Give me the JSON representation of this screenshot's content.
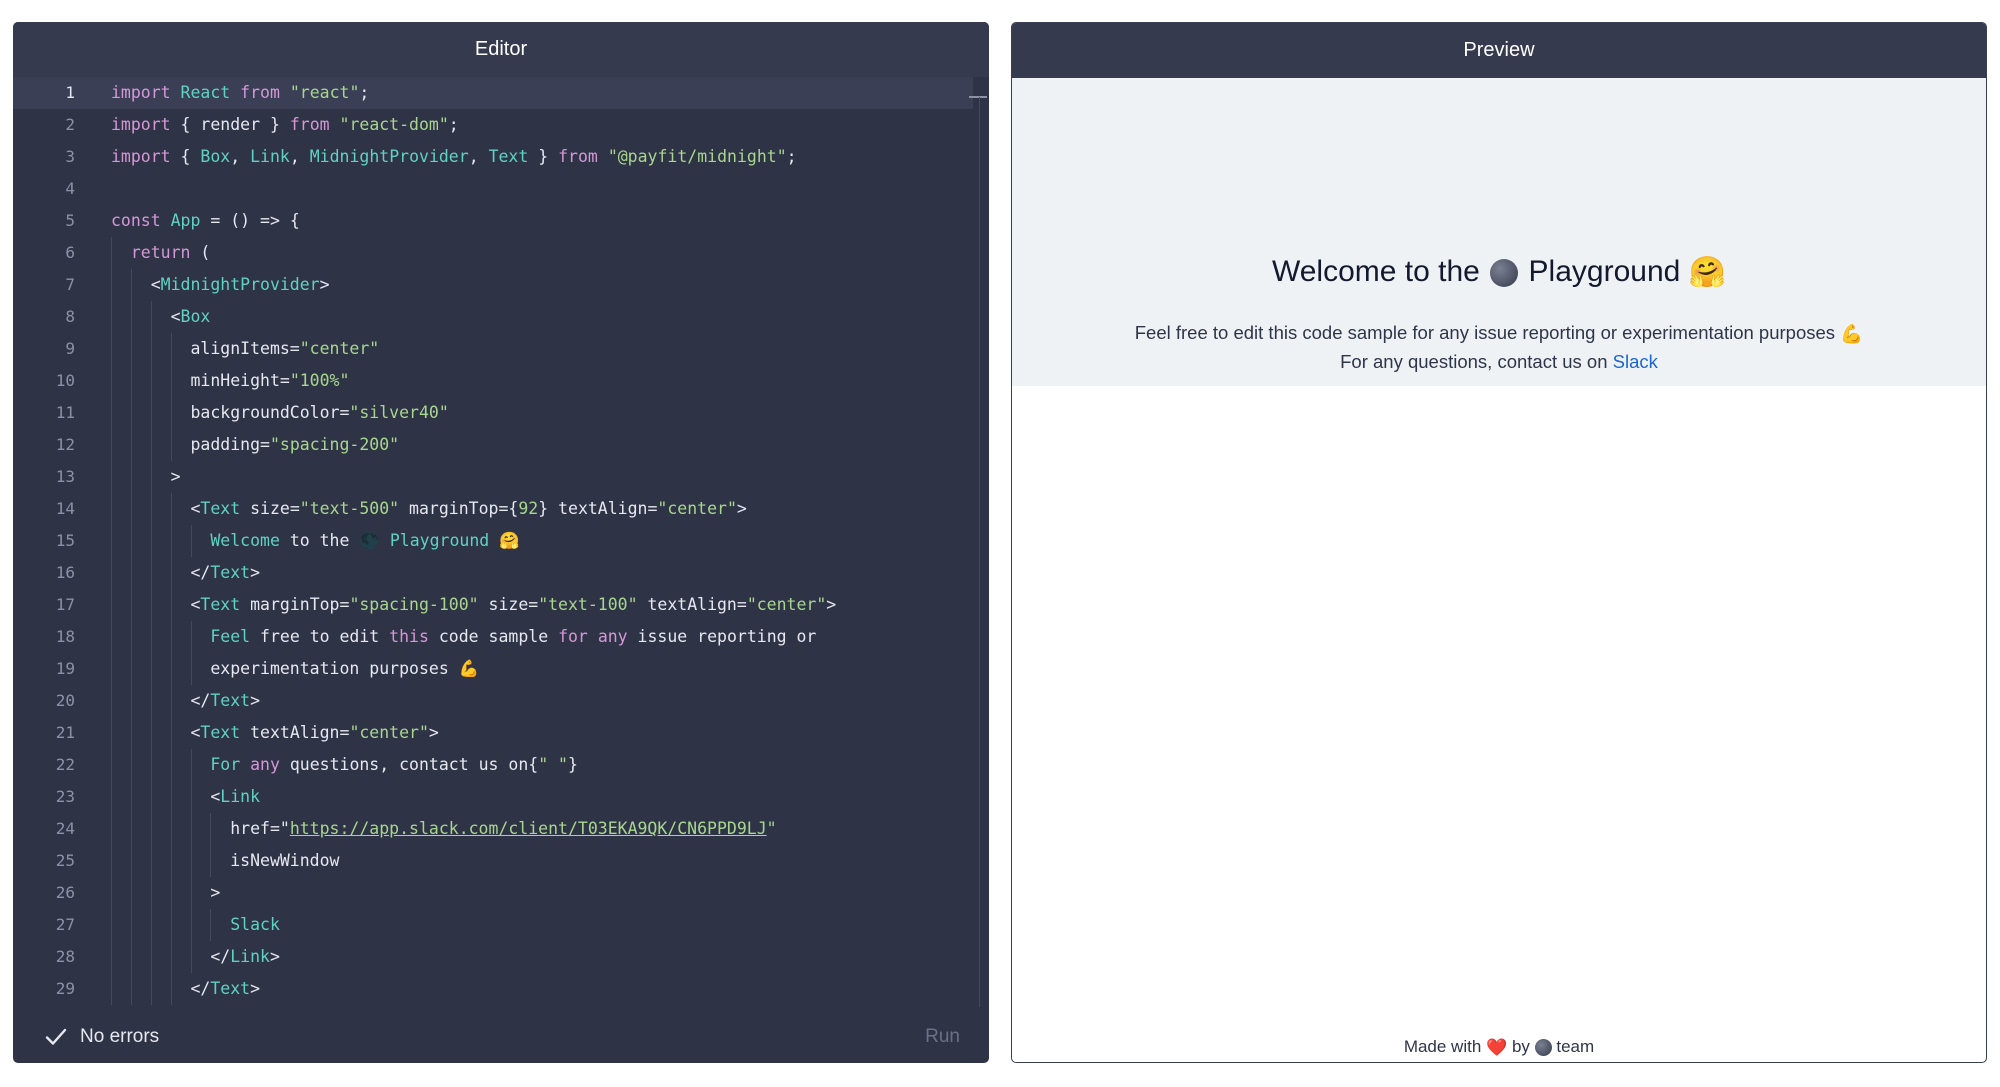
{
  "editor": {
    "title": "Editor",
    "lines": [
      [
        {
          "t": "import",
          "c": "kw"
        },
        {
          "t": " "
        },
        {
          "t": "React",
          "c": "ty"
        },
        {
          "t": " "
        },
        {
          "t": "from",
          "c": "kw"
        },
        {
          "t": " "
        },
        {
          "t": "\"react\"",
          "c": "st"
        },
        {
          "t": ";"
        }
      ],
      [
        {
          "t": "import",
          "c": "kw"
        },
        {
          "t": " { render } "
        },
        {
          "t": "from",
          "c": "kw"
        },
        {
          "t": " "
        },
        {
          "t": "\"react-dom\"",
          "c": "st"
        },
        {
          "t": ";"
        }
      ],
      [
        {
          "t": "import",
          "c": "kw"
        },
        {
          "t": " { "
        },
        {
          "t": "Box",
          "c": "ty"
        },
        {
          "t": ", "
        },
        {
          "t": "Link",
          "c": "ty"
        },
        {
          "t": ", "
        },
        {
          "t": "MidnightProvider",
          "c": "ty"
        },
        {
          "t": ", "
        },
        {
          "t": "Text",
          "c": "ty"
        },
        {
          "t": " } "
        },
        {
          "t": "from",
          "c": "kw"
        },
        {
          "t": " "
        },
        {
          "t": "\"@payfit/midnight\"",
          "c": "st"
        },
        {
          "t": ";"
        }
      ],
      [],
      [
        {
          "t": "const",
          "c": "kw"
        },
        {
          "t": " "
        },
        {
          "t": "App",
          "c": "ty"
        },
        {
          "t": " = () => {"
        }
      ],
      [
        {
          "t": "  "
        },
        {
          "t": "return",
          "c": "kw"
        },
        {
          "t": " ("
        }
      ],
      [
        {
          "t": "    <"
        },
        {
          "t": "MidnightProvider",
          "c": "ty"
        },
        {
          "t": ">"
        }
      ],
      [
        {
          "t": "      <"
        },
        {
          "t": "Box",
          "c": "ty"
        }
      ],
      [
        {
          "t": "        alignItems="
        },
        {
          "t": "\"center\"",
          "c": "st"
        }
      ],
      [
        {
          "t": "        minHeight="
        },
        {
          "t": "\"100%\"",
          "c": "st"
        }
      ],
      [
        {
          "t": "        backgroundColor="
        },
        {
          "t": "\"silver40\"",
          "c": "st"
        }
      ],
      [
        {
          "t": "        padding="
        },
        {
          "t": "\"spacing-200\"",
          "c": "st"
        }
      ],
      [
        {
          "t": "      >"
        }
      ],
      [
        {
          "t": "        <"
        },
        {
          "t": "Text",
          "c": "ty"
        },
        {
          "t": " size="
        },
        {
          "t": "\"text-500\"",
          "c": "st"
        },
        {
          "t": " marginTop={"
        },
        {
          "t": "92",
          "c": "st"
        },
        {
          "t": "} textAlign="
        },
        {
          "t": "\"center\"",
          "c": "st"
        },
        {
          "t": ">"
        }
      ],
      [
        {
          "t": "          "
        },
        {
          "t": "Welcome",
          "c": "ty"
        },
        {
          "t": " to the "
        },
        {
          "t": "🌑"
        },
        {
          "t": " "
        },
        {
          "t": "Playground",
          "c": "ty"
        },
        {
          "t": " "
        },
        {
          "t": "🤗"
        }
      ],
      [
        {
          "t": "        </"
        },
        {
          "t": "Text",
          "c": "ty"
        },
        {
          "t": ">"
        }
      ],
      [
        {
          "t": "        <"
        },
        {
          "t": "Text",
          "c": "ty"
        },
        {
          "t": " marginTop="
        },
        {
          "t": "\"spacing-100\"",
          "c": "st"
        },
        {
          "t": " size="
        },
        {
          "t": "\"text-100\"",
          "c": "st"
        },
        {
          "t": " textAlign="
        },
        {
          "t": "\"center\"",
          "c": "st"
        },
        {
          "t": ">"
        }
      ],
      [
        {
          "t": "          "
        },
        {
          "t": "Feel",
          "c": "ty"
        },
        {
          "t": " free to edit "
        },
        {
          "t": "this",
          "c": "kw"
        },
        {
          "t": " code sample "
        },
        {
          "t": "for",
          "c": "kw"
        },
        {
          "t": " "
        },
        {
          "t": "any",
          "c": "kw"
        },
        {
          "t": " issue reporting or"
        }
      ],
      [
        {
          "t": "          experimentation purposes "
        },
        {
          "t": "💪"
        }
      ],
      [
        {
          "t": "        </"
        },
        {
          "t": "Text",
          "c": "ty"
        },
        {
          "t": ">"
        }
      ],
      [
        {
          "t": "        <"
        },
        {
          "t": "Text",
          "c": "ty"
        },
        {
          "t": " textAlign="
        },
        {
          "t": "\"center\"",
          "c": "st"
        },
        {
          "t": ">"
        }
      ],
      [
        {
          "t": "          "
        },
        {
          "t": "For",
          "c": "ty"
        },
        {
          "t": " "
        },
        {
          "t": "any",
          "c": "kw"
        },
        {
          "t": " questions, contact us on{"
        },
        {
          "t": "\" \"",
          "c": "st"
        },
        {
          "t": "}"
        }
      ],
      [
        {
          "t": "          <"
        },
        {
          "t": "Link",
          "c": "ty"
        }
      ],
      [
        {
          "t": "            href=\""
        },
        {
          "t": "https://app.slack.com/client/T03EKA9QK/CN6PPD9LJ",
          "c": "st",
          "u": true
        },
        {
          "t": "\"",
          "c": "st"
        }
      ],
      [
        {
          "t": "            isNewWindow"
        }
      ],
      [
        {
          "t": "          >"
        }
      ],
      [
        {
          "t": "            "
        },
        {
          "t": "Slack",
          "c": "ty"
        }
      ],
      [
        {
          "t": "          </"
        },
        {
          "t": "Link",
          "c": "ty"
        },
        {
          "t": ">"
        }
      ],
      [
        {
          "t": "        </"
        },
        {
          "t": "Text",
          "c": "ty"
        },
        {
          "t": ">"
        }
      ]
    ],
    "status": "No errors",
    "run_label": "Run"
  },
  "preview": {
    "title": "Preview",
    "heading_before": "Welcome to the",
    "heading_after": "Playground",
    "heading_emoji": "🤗",
    "body_line1": "Feel free to edit this code sample for any issue reporting or experimentation purposes",
    "body_emoji": "💪",
    "body_line2": "For any questions, contact us on",
    "link_text": "Slack",
    "footer_before": "Made with",
    "footer_heart": "❤️",
    "footer_by": "by",
    "footer_after": "team"
  },
  "colors": {
    "editor_bg": "#2f3346",
    "header_bg": "#363a4f",
    "keyword": "#d597d8",
    "type": "#5fd3c3",
    "string": "#a7d68f",
    "link": "#1a66d6",
    "preview_box_bg": "#eff2f5"
  },
  "icons": [
    "check-icon",
    "moon-icon"
  ]
}
